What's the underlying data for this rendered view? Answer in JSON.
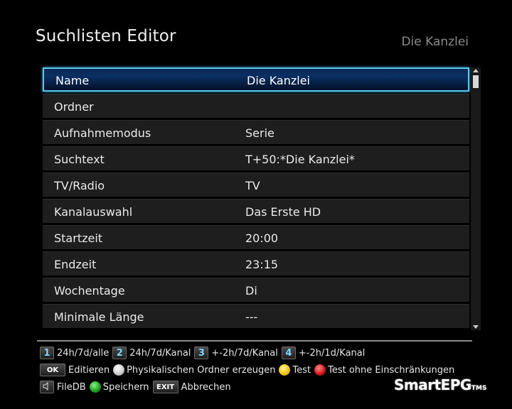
{
  "header": {
    "title": "Suchlisten Editor",
    "subtitle": "Die Kanzlei"
  },
  "rows": [
    {
      "label": "Name",
      "value": "Die Kanzlei"
    },
    {
      "label": "Ordner",
      "value": ""
    },
    {
      "label": "Aufnahmemodus",
      "value": "Serie"
    },
    {
      "label": "Suchtext",
      "value": "T+50:*Die Kanzlei*"
    },
    {
      "label": "TV/Radio",
      "value": "TV"
    },
    {
      "label": "Kanalauswahl",
      "value": "Das Erste HD"
    },
    {
      "label": "Startzeit",
      "value": "20:00"
    },
    {
      "label": "Endzeit",
      "value": "23:15"
    },
    {
      "label": "Wochentage",
      "value": "Di"
    },
    {
      "label": "Minimale Länge",
      "value": "---"
    }
  ],
  "help": {
    "key1": "1",
    "key1_label": "24h/7d/alle",
    "key2": "2",
    "key2_label": "24h/7d/Kanal",
    "key3": "3",
    "key3_label": "+-2h/7d/Kanal",
    "key4": "4",
    "key4_label": "+-2h/1d/Kanal",
    "ok_key": "OK",
    "ok_label": "Editieren",
    "white_label": "Physikalischen Ordner erzeugen",
    "yellow_label": "Test",
    "red_label": "Test ohne Einschränkungen",
    "filedb_label": "FileDB",
    "green_label": "Speichern",
    "exit_key": "EXIT",
    "exit_label": "Abbrechen"
  },
  "logo": {
    "text": "SmartEPG",
    "tm": "TMS"
  },
  "icons": {
    "white": "white-button-icon",
    "yellow": "yellow-button-icon",
    "red": "red-button-icon",
    "green": "green-button-icon",
    "filedb": "speaker-key-icon"
  },
  "colors": {
    "selection_border": "#5fc3ea",
    "key_text": "#7fd3ff"
  }
}
